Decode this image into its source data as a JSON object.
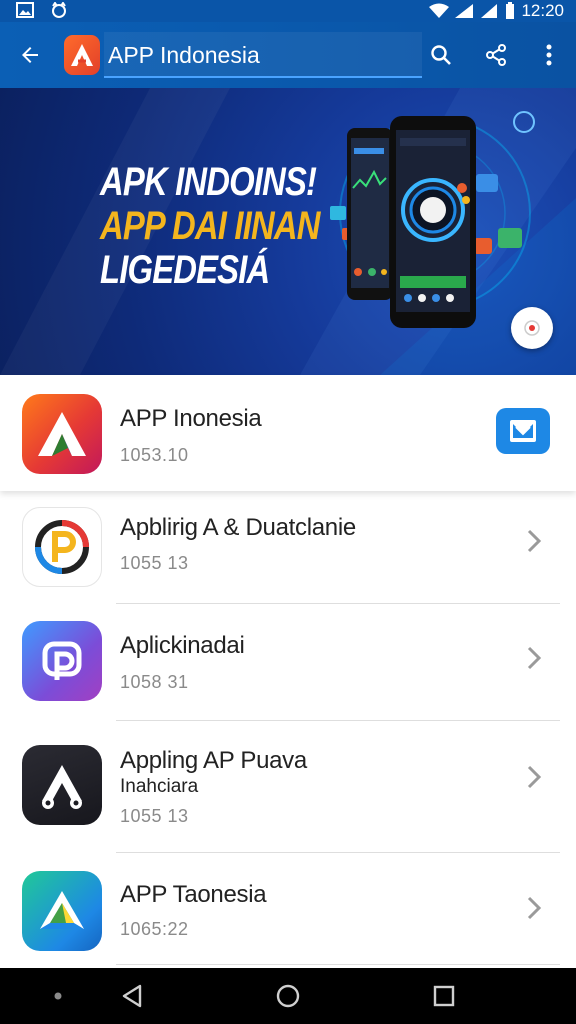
{
  "status_bar": {
    "time": "12:20",
    "icons": [
      "image-icon",
      "cat-icon",
      "wifi-icon",
      "signal-icon",
      "signal-icon",
      "battery-icon"
    ]
  },
  "app_bar": {
    "title": "APP Indonesia",
    "icons": {
      "back": "arrow-back-icon",
      "logo": "app-logo-icon",
      "search": "search-icon",
      "share": "share-icon",
      "more": "more-vert-icon"
    }
  },
  "banner": {
    "line1": "APK INDOINS!",
    "line2": "APP DAI IINAN",
    "line3": "LIGEDESIÁ",
    "accent_color": "#f4b51e"
  },
  "list": {
    "featured": {
      "title": "APP Inonesia",
      "meta": "1053.10",
      "action_icon": "mail-icon"
    },
    "items": [
      {
        "title": "Apblirig A & Duatclanie",
        "subtitle": "",
        "meta": "1055 13"
      },
      {
        "title": "Aplickinadai",
        "subtitle": "",
        "meta": "1058 31"
      },
      {
        "title": "Appling AP Puava",
        "subtitle": "Inahciara",
        "meta": "1055 13"
      },
      {
        "title": "APP Taonesia",
        "subtitle": "",
        "meta": "1065:22"
      }
    ]
  },
  "nav_bar": {
    "icons": [
      "dot-icon",
      "back-triangle-icon",
      "home-circle-icon",
      "recents-square-icon"
    ]
  },
  "colors": {
    "app_bar": "#0a58ab",
    "accent": "#1e88e5",
    "banner_bg": "#153a9a"
  }
}
